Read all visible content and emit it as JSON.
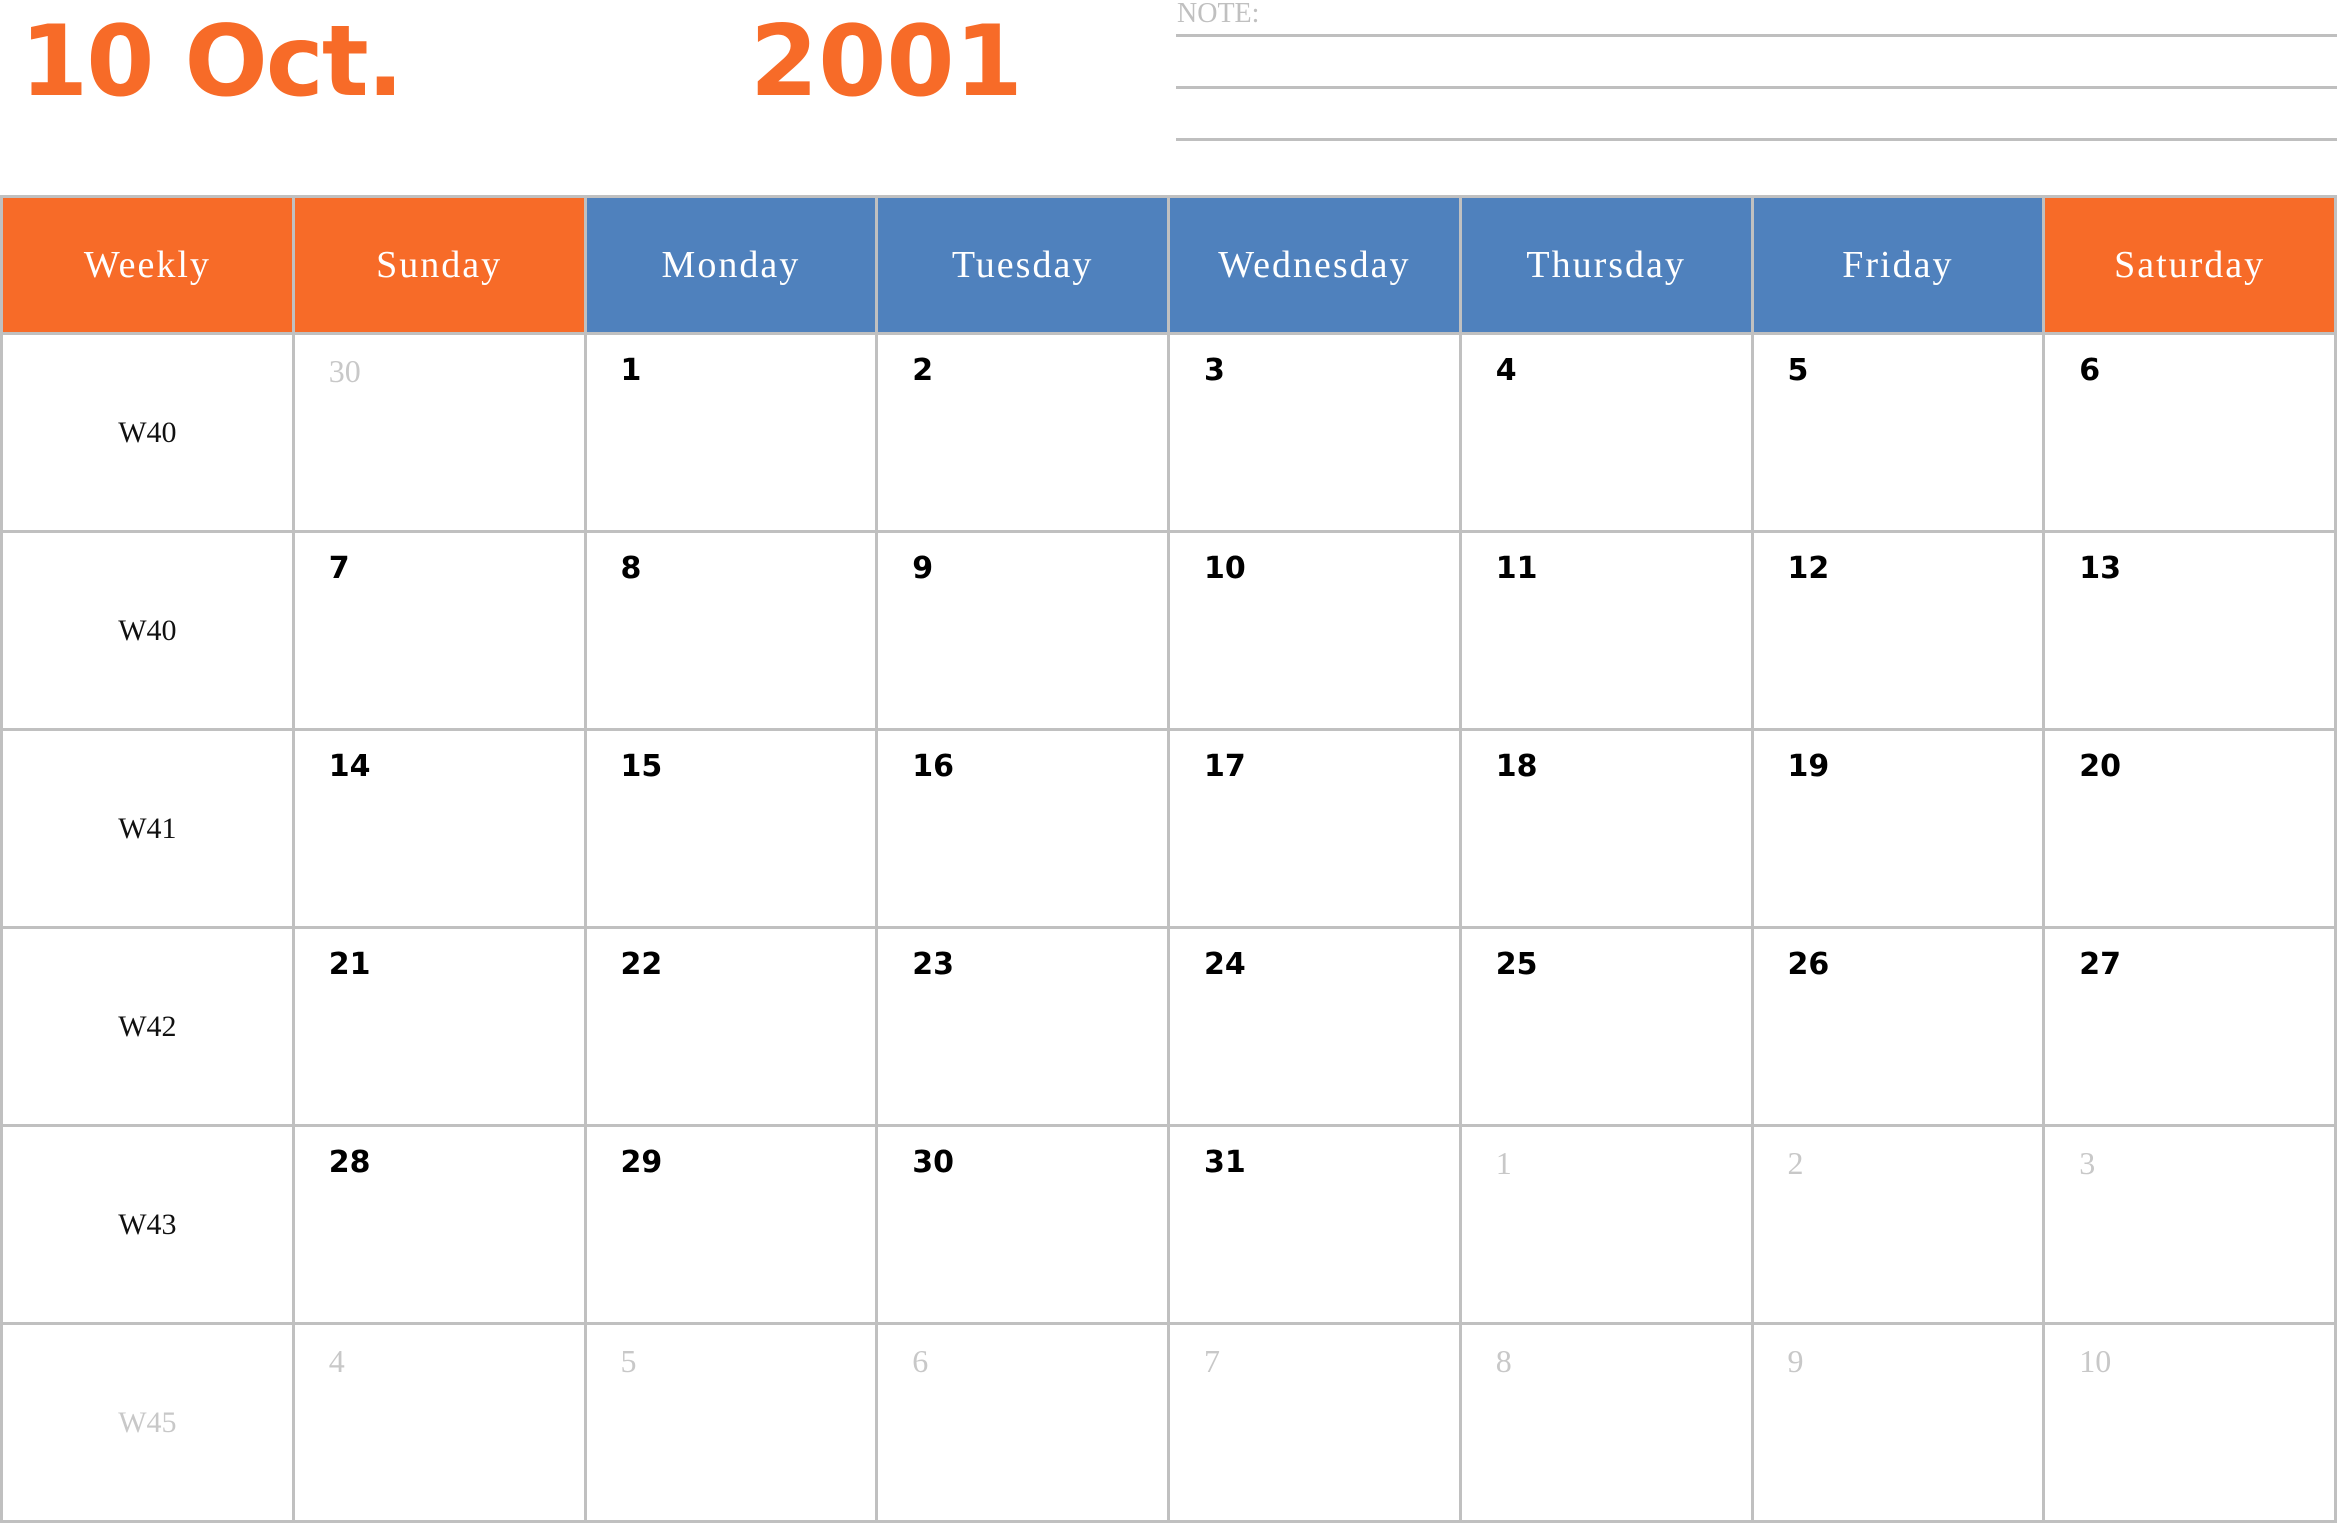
{
  "header": {
    "title": "10 Oct.",
    "year": "2001",
    "note_label": "NOTE:"
  },
  "colors": {
    "accent_orange": "#f76b28",
    "accent_blue": "#4f81bd",
    "grid_line": "#c0c0c0",
    "faded_text": "#c8c8c8"
  },
  "calendar": {
    "columns": [
      {
        "label": "Weekly",
        "color": "orange"
      },
      {
        "label": "Sunday",
        "color": "orange"
      },
      {
        "label": "Monday",
        "color": "blue"
      },
      {
        "label": "Tuesday",
        "color": "blue"
      },
      {
        "label": "Wednesday",
        "color": "blue"
      },
      {
        "label": "Thursday",
        "color": "blue"
      },
      {
        "label": "Friday",
        "color": "blue"
      },
      {
        "label": "Saturday",
        "color": "orange"
      }
    ],
    "rows": [
      {
        "week": "W40",
        "week_faded": false,
        "days": [
          {
            "d": "30",
            "faded": true
          },
          {
            "d": "1",
            "faded": false
          },
          {
            "d": "2",
            "faded": false
          },
          {
            "d": "3",
            "faded": false
          },
          {
            "d": "4",
            "faded": false
          },
          {
            "d": "5",
            "faded": false
          },
          {
            "d": "6",
            "faded": false
          }
        ]
      },
      {
        "week": "W40",
        "week_faded": false,
        "days": [
          {
            "d": "7",
            "faded": false
          },
          {
            "d": "8",
            "faded": false
          },
          {
            "d": "9",
            "faded": false
          },
          {
            "d": "10",
            "faded": false
          },
          {
            "d": "11",
            "faded": false
          },
          {
            "d": "12",
            "faded": false
          },
          {
            "d": "13",
            "faded": false
          }
        ]
      },
      {
        "week": "W41",
        "week_faded": false,
        "days": [
          {
            "d": "14",
            "faded": false
          },
          {
            "d": "15",
            "faded": false
          },
          {
            "d": "16",
            "faded": false
          },
          {
            "d": "17",
            "faded": false
          },
          {
            "d": "18",
            "faded": false
          },
          {
            "d": "19",
            "faded": false
          },
          {
            "d": "20",
            "faded": false
          }
        ]
      },
      {
        "week": "W42",
        "week_faded": false,
        "days": [
          {
            "d": "21",
            "faded": false
          },
          {
            "d": "22",
            "faded": false
          },
          {
            "d": "23",
            "faded": false
          },
          {
            "d": "24",
            "faded": false
          },
          {
            "d": "25",
            "faded": false
          },
          {
            "d": "26",
            "faded": false
          },
          {
            "d": "27",
            "faded": false
          }
        ]
      },
      {
        "week": "W43",
        "week_faded": false,
        "days": [
          {
            "d": "28",
            "faded": false
          },
          {
            "d": "29",
            "faded": false
          },
          {
            "d": "30",
            "faded": false
          },
          {
            "d": "31",
            "faded": false
          },
          {
            "d": "1",
            "faded": true
          },
          {
            "d": "2",
            "faded": true
          },
          {
            "d": "3",
            "faded": true
          }
        ]
      },
      {
        "week": "W45",
        "week_faded": true,
        "days": [
          {
            "d": "4",
            "faded": true
          },
          {
            "d": "5",
            "faded": true
          },
          {
            "d": "6",
            "faded": true
          },
          {
            "d": "7",
            "faded": true
          },
          {
            "d": "8",
            "faded": true
          },
          {
            "d": "9",
            "faded": true
          },
          {
            "d": "10",
            "faded": true
          }
        ]
      }
    ]
  }
}
